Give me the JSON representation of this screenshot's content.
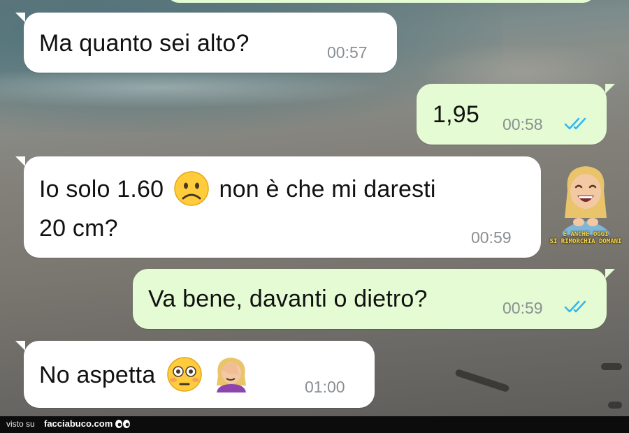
{
  "chat": {
    "messages": [
      {
        "direction": "incoming",
        "text": "Ma quanto sei alto?",
        "time": "00:57"
      },
      {
        "direction": "outgoing",
        "text": "1,95",
        "time": "00:58",
        "status": "read-double-check-icon"
      },
      {
        "direction": "incoming",
        "text_line1_a": "Io solo 1.60",
        "emoji_1": "frowning-face-emoji",
        "text_line1_b": "non è che mi daresti",
        "text_line2": "20 cm?",
        "time": "00:59"
      },
      {
        "direction": "outgoing",
        "text": "Va bene, davanti o dietro?",
        "time": "00:59",
        "status": "read-double-check-icon"
      },
      {
        "direction": "incoming",
        "text": "No aspetta",
        "emoji_1": "flushed-face-emoji",
        "emoji_2": "woman-facepalming-emoji",
        "time": "01:00"
      }
    ],
    "sticker": {
      "caption_line1": "E ANCHE OGGI",
      "caption_line2": "SI RIMORCHIA DOMANI",
      "icon": "laughing-woman-sticker"
    }
  },
  "footer": {
    "label": "visto su",
    "brand": "facciabuco.com",
    "icon": "eyes-icon"
  },
  "colors": {
    "incoming_bubble": "#ffffff",
    "outgoing_bubble": "#e4fbd3",
    "read_tick": "#34b7f1",
    "time_text": "#8a8f93"
  }
}
